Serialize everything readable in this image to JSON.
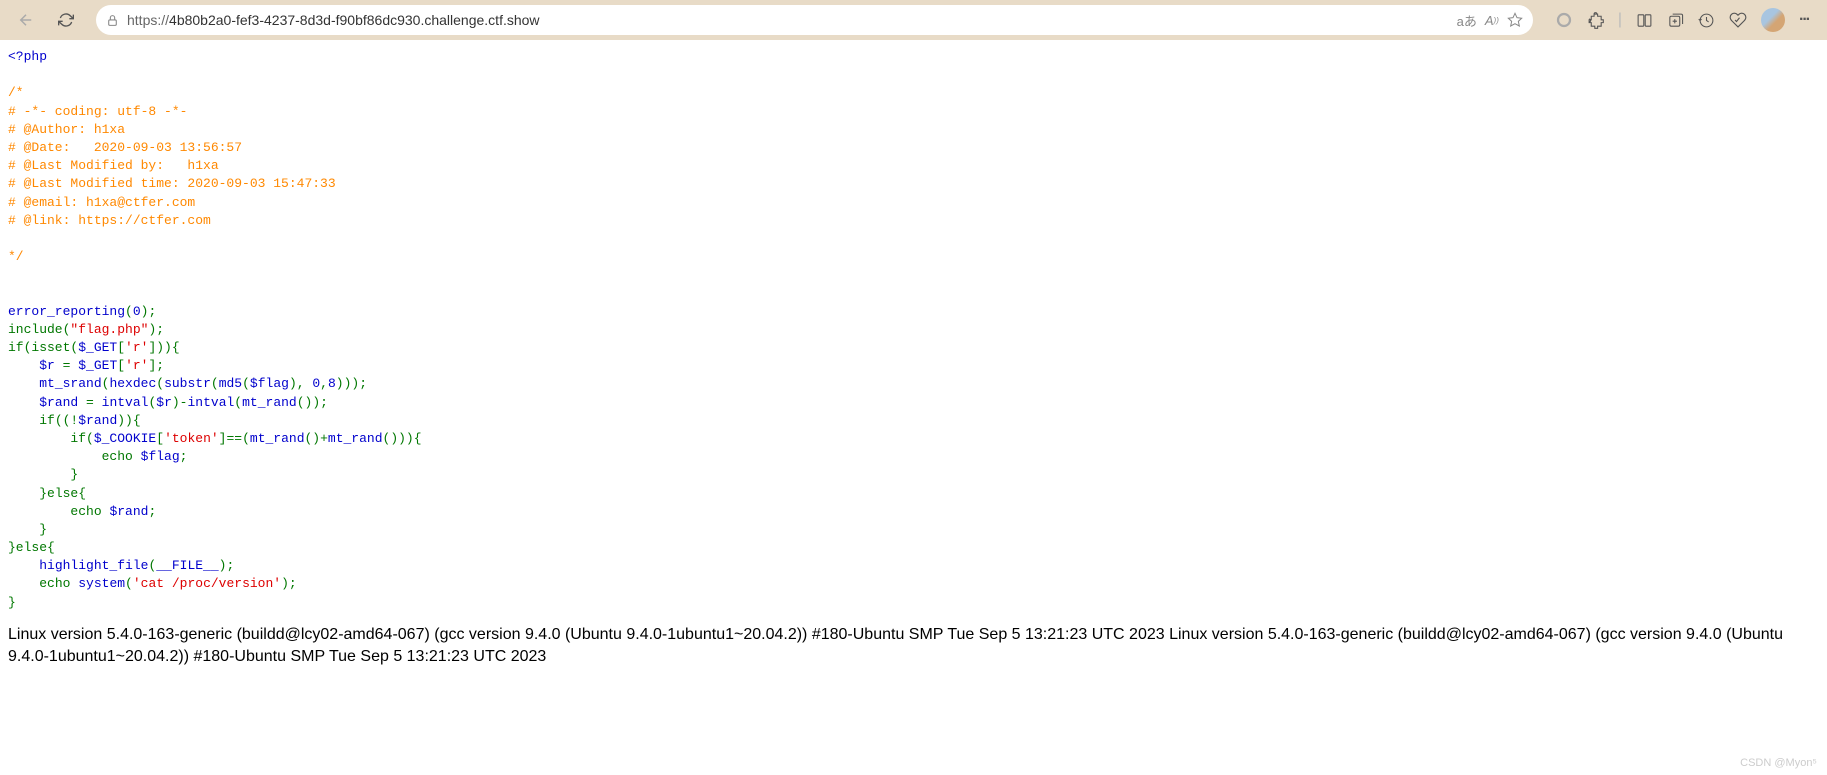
{
  "toolbar": {
    "url_prefix": "https://",
    "url_host": "4b80b2a0-fef3-4237-8d3d-f90bf86dc930.challenge.ctf.show",
    "translate_label": "aあ",
    "read_aloud_label": "A"
  },
  "code": {
    "php_open": "<?php",
    "comment_block": "/*\n# -*- coding: utf-8 -*-\n# @Author: h1xa\n# @Date:   2020-09-03 13:56:57\n# @Last Modified by:   h1xa\n# @Last Modified time: 2020-09-03 15:47:33\n# @email: h1xa@ctfer.com\n# @link: https://ctfer.com\n\n*/",
    "line_error": "error_reporting",
    "line_error_args": "(",
    "line_error_zero": "0",
    "line_error_close": ");",
    "line_include": "include(",
    "line_include_str": "\"flag.php\"",
    "line_include_close": ");",
    "line_if_isset": "if(isset(",
    "line_get_r_var": "$_GET",
    "line_get_r_br": "[",
    "line_get_r_key": "'r'",
    "line_get_r_close": "])){",
    "line_r_assign_var": "$r ",
    "line_r_assign_eq": "= ",
    "line_r_assign_get": "$_GET",
    "line_r_assign_br": "[",
    "line_r_assign_key": "'r'",
    "line_r_assign_close": "];",
    "line_srand": "mt_srand",
    "line_srand_open": "(",
    "line_hexdec": "hexdec",
    "line_hexdec_open": "(",
    "line_substr": "substr",
    "line_substr_open": "(",
    "line_md5": "md5",
    "line_md5_open": "(",
    "line_flag_var": "$flag",
    "line_md5_close": "),",
    "line_substr_args": "0",
    "line_substr_comma": ",",
    "line_substr_eight": "8",
    "line_srand_close": ")));",
    "line_rand_var": "$rand ",
    "line_rand_eq": "= ",
    "line_intval1": "intval",
    "line_intval1_open": "(",
    "line_r_var": "$r",
    "line_intval1_close": ")-",
    "line_intval2": "intval",
    "line_intval2_open": "(",
    "line_mtrand1": "mt_rand",
    "line_mtrand1_call": "());",
    "line_if_not": "if((!",
    "line_rand_var2": "$rand",
    "line_if_not_close": ")){",
    "line_if_cookie": "if(",
    "line_cookie_var": "$_COOKIE",
    "line_cookie_br": "[",
    "line_cookie_key": "'token'",
    "line_cookie_eq": "]==(",
    "line_mtrand2": "mt_rand",
    "line_mtrand2_plus": "()+",
    "line_mtrand3": "mt_rand",
    "line_mtrand3_close": "())){",
    "line_echo1": "echo ",
    "line_flag_var2": "$flag",
    "line_echo1_close": ";",
    "line_close_brace1": "}",
    "line_else1": "}else{",
    "line_echo2": "echo ",
    "line_rand_var3": "$rand",
    "line_echo2_close": ";",
    "line_close_brace2": "}",
    "line_else2": "}else{",
    "line_highlight": "highlight_file",
    "line_highlight_open": "(",
    "line_file_const": "__FILE__",
    "line_highlight_close": ");",
    "line_echo3": "echo ",
    "line_system": "system",
    "line_system_open": "(",
    "line_system_str": "'cat /proc/version'",
    "line_system_close": ");",
    "line_final_brace": "}"
  },
  "output": {
    "text": "Linux version 5.4.0-163-generic (buildd@lcy02-amd64-067) (gcc version 9.4.0 (Ubuntu 9.4.0-1ubuntu1~20.04.2)) #180-Ubuntu SMP Tue Sep 5 13:21:23 UTC 2023 Linux version 5.4.0-163-generic (buildd@lcy02-amd64-067) (gcc version 9.4.0 (Ubuntu 9.4.0-1ubuntu1~20.04.2)) #180-Ubuntu SMP Tue Sep 5 13:21:23 UTC 2023"
  },
  "watermark": "CSDN @Myon⁵"
}
